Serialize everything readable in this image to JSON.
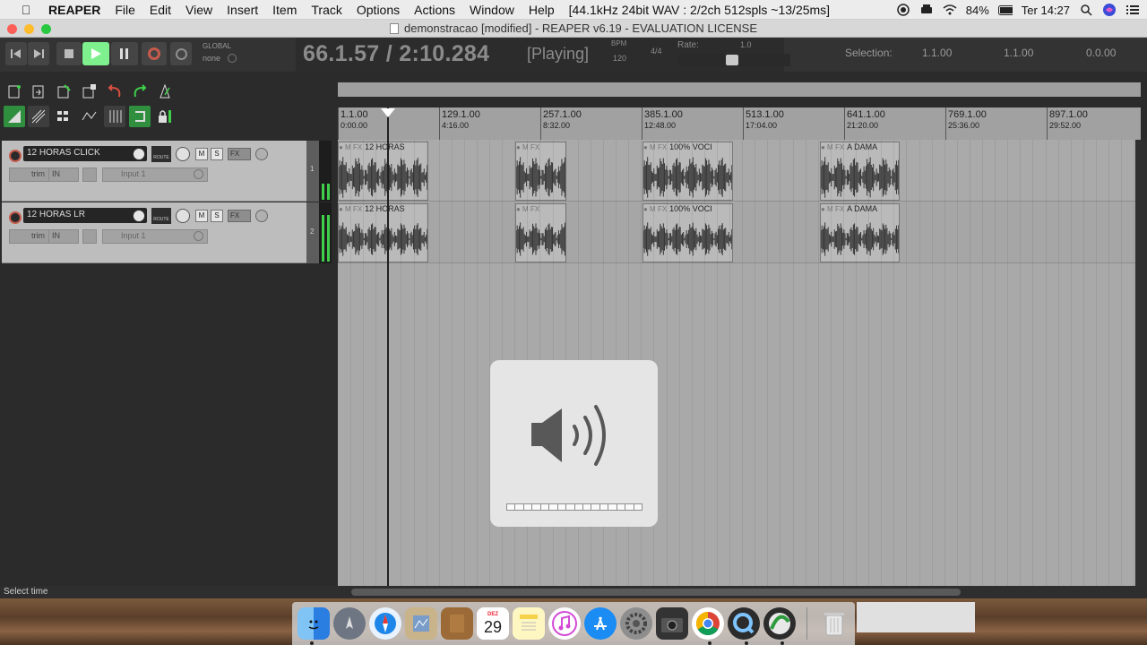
{
  "menubar": {
    "app": "REAPER",
    "items": [
      "File",
      "Edit",
      "View",
      "Insert",
      "Item",
      "Track",
      "Options",
      "Actions",
      "Window",
      "Help"
    ],
    "audio_info": "[44.1kHz 24bit WAV : 2/2ch 512spls ~13/25ms]",
    "battery": "84%",
    "clock": "Ter 14:27"
  },
  "window": {
    "title": "demonstracao [modified] - REAPER v6.19 - EVALUATION LICENSE"
  },
  "transport": {
    "global_label": "GLOBAL",
    "global_value": "none",
    "position": "66.1.57 / 2:10.284",
    "state": "[Playing]",
    "bpm_label": "BPM",
    "bpm": "120",
    "time_signature": "4/4",
    "rate_label": "Rate:",
    "rate": "1.0",
    "selection_label": "Selection:",
    "selection_start": "1.1.00",
    "selection_end": "1.1.00",
    "selection_length": "0.0.00"
  },
  "tracks": [
    {
      "number": "1",
      "name": "12 HORAS CLICK",
      "input": "Input 1"
    },
    {
      "number": "2",
      "name": "12 HORAS LR",
      "input": "Input 1"
    }
  ],
  "track_buttons": {
    "mute": "M",
    "solo": "S",
    "fx": "FX",
    "trim": "trim",
    "in": "IN",
    "route": "ROUTE"
  },
  "ruler": [
    {
      "bar": "1.1.00",
      "time": "0:00.00"
    },
    {
      "bar": "129.1.00",
      "time": "4:16.00"
    },
    {
      "bar": "257.1.00",
      "time": "8:32.00"
    },
    {
      "bar": "385.1.00",
      "time": "12:48.00"
    },
    {
      "bar": "513.1.00",
      "time": "17:04.00"
    },
    {
      "bar": "641.1.00",
      "time": "21:20.00"
    },
    {
      "bar": "769.1.00",
      "time": "25:36.00"
    },
    {
      "bar": "897.1.00",
      "time": "29:52.00"
    }
  ],
  "items": {
    "track1": [
      {
        "label": "12 HORAS"
      },
      {
        "label": ""
      },
      {
        "label": "100% VOCI"
      },
      {
        "label": "A DAMA"
      }
    ],
    "track2": [
      {
        "label": "12 HORAS"
      },
      {
        "label": ""
      },
      {
        "label": "100% VOCI"
      },
      {
        "label": "A DAMA"
      }
    ],
    "header_icons": "M FX"
  },
  "status": "Select time",
  "dock": {
    "calendar_month": "DEZ",
    "calendar_day": "29"
  },
  "volume_level": 1.0,
  "colors": {
    "play_active": "#7ef08e",
    "record": "#c65b4c",
    "meter": "#3fcf4a"
  }
}
